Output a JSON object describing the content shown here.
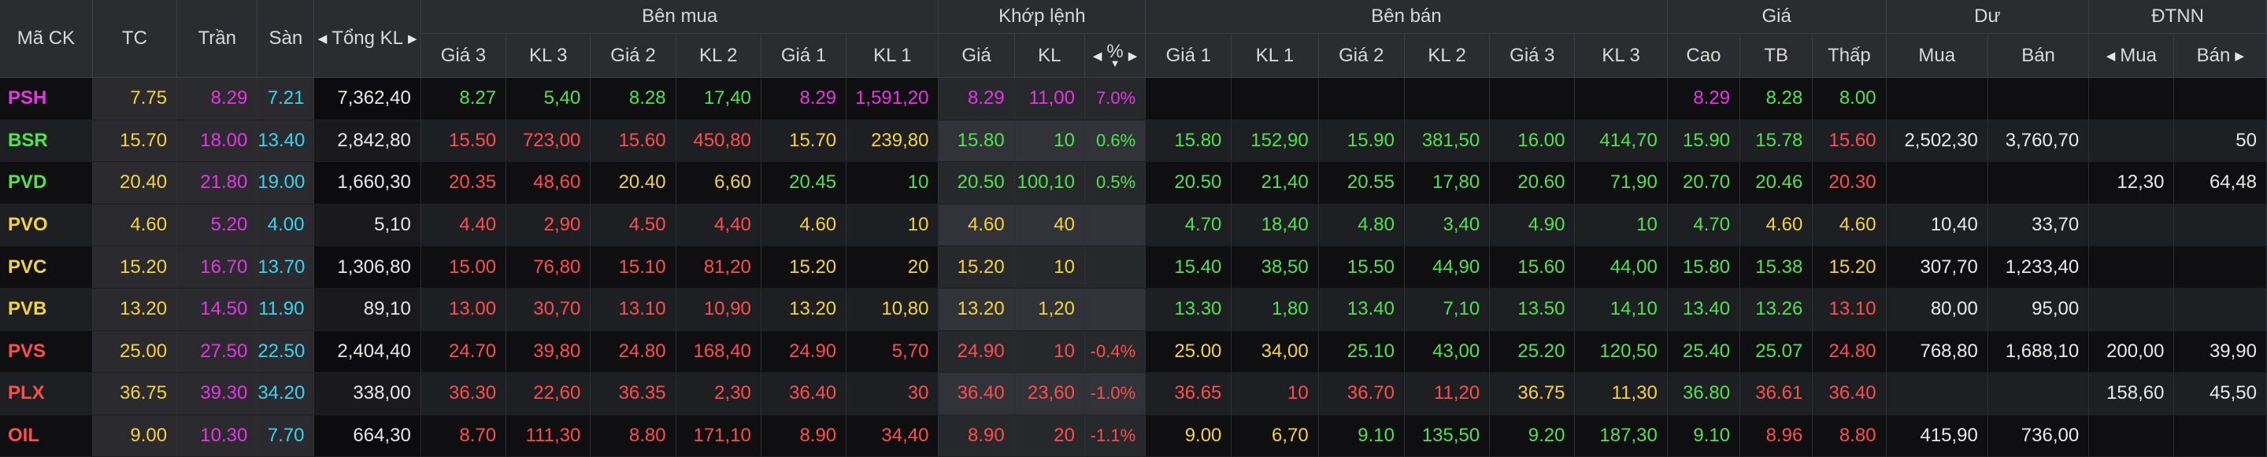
{
  "header": {
    "ma_ck": "Mã CK",
    "tc": "TC",
    "tran": "Trần",
    "san": "Sàn",
    "tong_kl": "Tổng KL",
    "ben_mua": "Bên mua",
    "khop_lenh": "Khớp lệnh",
    "ben_ban": "Bên bán",
    "gia_group": "Giá",
    "du": "Dư",
    "dtnn": "ĐTNN",
    "gia3": "Giá 3",
    "kl3": "KL 3",
    "gia2": "Giá 2",
    "kl2": "KL 2",
    "gia1": "Giá 1",
    "kl1": "KL 1",
    "gia": "Giá",
    "kl": "KL",
    "pct": "%",
    "cao": "Cao",
    "tb": "TB",
    "thap": "Thấp",
    "mua": "Mua",
    "ban": "Bán"
  },
  "colors": {
    "ceiling": "#e535e5",
    "floor": "#35d5f0",
    "ref": "#f2d33b",
    "up": "#4fe34f",
    "down": "#ff4d4d",
    "neutral": "#e8e8e8"
  },
  "rows": [
    {
      "c": [
        "PSH",
        "7.75",
        "8.29",
        "7.21",
        "7,362,40",
        "8.27",
        "5,40",
        "8.28",
        "17,40",
        "8.29",
        "1,591,20",
        "8.29",
        "11,00",
        "7.0%",
        "",
        "",
        "",
        "",
        "",
        "",
        "8.29",
        "8.28",
        "8.00",
        "",
        "",
        "",
        ""
      ],
      "k": [
        "ce",
        "ref",
        "ce",
        "fl",
        "neu",
        "up",
        "up",
        "up",
        "up",
        "ce",
        "ce",
        "ce",
        "ce",
        "ce",
        "up",
        "up",
        "up",
        "up",
        "up",
        "up",
        "ce",
        "up",
        "up",
        "neu",
        "neu",
        "neu",
        "neu"
      ]
    },
    {
      "c": [
        "BSR",
        "15.70",
        "18.00",
        "13.40",
        "2,842,80",
        "15.50",
        "723,00",
        "15.60",
        "450,80",
        "15.70",
        "239,80",
        "15.80",
        "10",
        "0.6%",
        "15.80",
        "152,90",
        "15.90",
        "381,50",
        "16.00",
        "414,70",
        "15.90",
        "15.78",
        "15.60",
        "2,502,30",
        "3,760,70",
        "",
        "50"
      ],
      "k": [
        "up",
        "ref",
        "ce",
        "fl",
        "neu",
        "dn",
        "dn",
        "dn",
        "dn",
        "ref",
        "ref",
        "up",
        "up",
        "up",
        "up",
        "up",
        "up",
        "up",
        "up",
        "up",
        "up",
        "up",
        "dn",
        "neu",
        "neu",
        "neu",
        "neu"
      ]
    },
    {
      "c": [
        "PVD",
        "20.40",
        "21.80",
        "19.00",
        "1,660,30",
        "20.35",
        "48,60",
        "20.40",
        "6,60",
        "20.45",
        "10",
        "20.50",
        "100,10",
        "0.5%",
        "20.50",
        "21,40",
        "20.55",
        "17,80",
        "20.60",
        "71,90",
        "20.70",
        "20.46",
        "20.30",
        "",
        "",
        "12,30",
        "64,48"
      ],
      "k": [
        "up",
        "ref",
        "ce",
        "fl",
        "neu",
        "dn",
        "dn",
        "ref",
        "ref",
        "up",
        "up",
        "up",
        "up",
        "up",
        "up",
        "up",
        "up",
        "up",
        "up",
        "up",
        "up",
        "up",
        "dn",
        "neu",
        "neu",
        "neu",
        "neu"
      ]
    },
    {
      "c": [
        "PVO",
        "4.60",
        "5.20",
        "4.00",
        "5,10",
        "4.40",
        "2,90",
        "4.50",
        "4,40",
        "4.60",
        "10",
        "4.60",
        "40",
        "",
        "4.70",
        "18,40",
        "4.80",
        "3,40",
        "4.90",
        "10",
        "4.70",
        "4.60",
        "4.60",
        "10,40",
        "33,70",
        "",
        ""
      ],
      "k": [
        "ref",
        "ref",
        "ce",
        "fl",
        "neu",
        "dn",
        "dn",
        "dn",
        "dn",
        "ref",
        "ref",
        "ref",
        "ref",
        "ref",
        "up",
        "up",
        "up",
        "up",
        "up",
        "up",
        "up",
        "ref",
        "ref",
        "neu",
        "neu",
        "neu",
        "neu"
      ]
    },
    {
      "c": [
        "PVC",
        "15.20",
        "16.70",
        "13.70",
        "1,306,80",
        "15.00",
        "76,80",
        "15.10",
        "81,20",
        "15.20",
        "20",
        "15.20",
        "10",
        "",
        "15.40",
        "38,50",
        "15.50",
        "44,90",
        "15.60",
        "44,00",
        "15.80",
        "15.38",
        "15.20",
        "307,70",
        "1,233,40",
        "",
        ""
      ],
      "k": [
        "ref",
        "ref",
        "ce",
        "fl",
        "neu",
        "dn",
        "dn",
        "dn",
        "dn",
        "ref",
        "ref",
        "ref",
        "ref",
        "ref",
        "up",
        "up",
        "up",
        "up",
        "up",
        "up",
        "up",
        "up",
        "ref",
        "neu",
        "neu",
        "neu",
        "neu"
      ]
    },
    {
      "c": [
        "PVB",
        "13.20",
        "14.50",
        "11.90",
        "89,10",
        "13.00",
        "30,70",
        "13.10",
        "10,90",
        "13.20",
        "10,80",
        "13.20",
        "1,20",
        "",
        "13.30",
        "1,80",
        "13.40",
        "7,10",
        "13.50",
        "14,10",
        "13.40",
        "13.26",
        "13.10",
        "80,00",
        "95,00",
        "",
        ""
      ],
      "k": [
        "ref",
        "ref",
        "ce",
        "fl",
        "neu",
        "dn",
        "dn",
        "dn",
        "dn",
        "ref",
        "ref",
        "ref",
        "ref",
        "ref",
        "up",
        "up",
        "up",
        "up",
        "up",
        "up",
        "up",
        "up",
        "dn",
        "neu",
        "neu",
        "neu",
        "neu"
      ]
    },
    {
      "c": [
        "PVS",
        "25.00",
        "27.50",
        "22.50",
        "2,404,40",
        "24.70",
        "39,80",
        "24.80",
        "168,40",
        "24.90",
        "5,70",
        "24.90",
        "10",
        "-0.4%",
        "25.00",
        "34,00",
        "25.10",
        "43,00",
        "25.20",
        "120,50",
        "25.40",
        "25.07",
        "24.80",
        "768,80",
        "1,688,10",
        "200,00",
        "39,90"
      ],
      "k": [
        "dn",
        "ref",
        "ce",
        "fl",
        "neu",
        "dn",
        "dn",
        "dn",
        "dn",
        "dn",
        "dn",
        "dn",
        "dn",
        "dn",
        "ref",
        "ref",
        "up",
        "up",
        "up",
        "up",
        "up",
        "up",
        "dn",
        "neu",
        "neu",
        "neu",
        "neu"
      ]
    },
    {
      "c": [
        "PLX",
        "36.75",
        "39.30",
        "34.20",
        "338,00",
        "36.30",
        "22,60",
        "36.35",
        "2,30",
        "36.40",
        "30",
        "36.40",
        "23,60",
        "-1.0%",
        "36.65",
        "10",
        "36.70",
        "11,20",
        "36.75",
        "11,30",
        "36.80",
        "36.61",
        "36.40",
        "",
        "",
        "158,60",
        "45,50"
      ],
      "k": [
        "dn",
        "ref",
        "ce",
        "fl",
        "neu",
        "dn",
        "dn",
        "dn",
        "dn",
        "dn",
        "dn",
        "dn",
        "dn",
        "dn",
        "dn",
        "dn",
        "dn",
        "dn",
        "ref",
        "ref",
        "up",
        "dn",
        "dn",
        "neu",
        "neu",
        "neu",
        "neu"
      ]
    },
    {
      "c": [
        "OIL",
        "9.00",
        "10.30",
        "7.70",
        "664,30",
        "8.70",
        "111,30",
        "8.80",
        "171,10",
        "8.90",
        "34,40",
        "8.90",
        "20",
        "-1.1%",
        "9.00",
        "6,70",
        "9.10",
        "135,50",
        "9.20",
        "187,30",
        "9.10",
        "8.96",
        "8.80",
        "415,90",
        "736,00",
        "",
        ""
      ],
      "k": [
        "dn",
        "ref",
        "ce",
        "fl",
        "neu",
        "dn",
        "dn",
        "dn",
        "dn",
        "dn",
        "dn",
        "dn",
        "dn",
        "dn",
        "ref",
        "ref",
        "up",
        "up",
        "up",
        "up",
        "up",
        "dn",
        "dn",
        "neu",
        "neu",
        "neu",
        "neu"
      ]
    }
  ]
}
